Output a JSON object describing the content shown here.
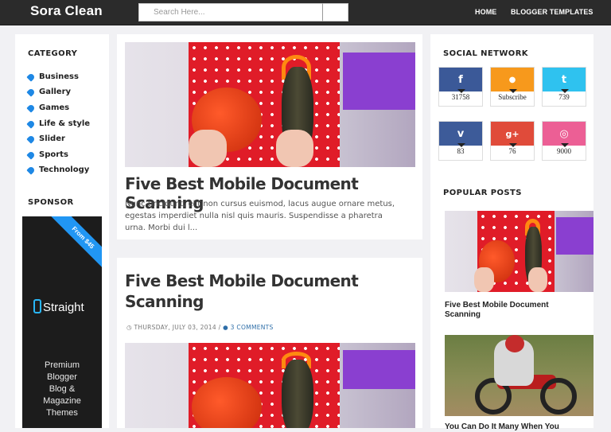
{
  "header": {
    "logo": "Sora Clean",
    "search_placeholder": "Search Here...",
    "nav": [
      "HOME",
      "BLOGGER TEMPLATES"
    ]
  },
  "left_sidebar": {
    "category_title": "CATEGORY",
    "categories": [
      "Business",
      "Gallery",
      "Games",
      "Life & style",
      "Slider",
      "Sports",
      "Technology"
    ],
    "sponsor_title": "SPONSOR",
    "sponsor": {
      "ribbon": "From $45",
      "brand": "Straight",
      "promo_lines": [
        "Premium",
        "Blogger",
        "Blog &",
        "Magazine",
        "Themes"
      ]
    }
  },
  "posts": [
    {
      "title": "Five Best Mobile Document Scanning",
      "excerpt_lines": [
        "Nunc tincidunt, elit non cursus euismod, lacus augue ornare metus,",
        "egestas imperdiet nulla nisl quis mauris. Suspendisse a pharetra",
        "urna. Morbi dui l..."
      ]
    },
    {
      "title_lines": [
        "Five Best Mobile Document",
        "Scanning"
      ],
      "date": "THURSDAY, JULY 03, 2014",
      "separator": "/",
      "comments": "3 COMMENTS"
    }
  ],
  "right_sidebar": {
    "social_title": "SOCIAL NETWORK",
    "social": [
      {
        "icon": "facebook-icon",
        "glyph": "f",
        "color": "#3b5998",
        "count": "31758"
      },
      {
        "icon": "rss-icon",
        "glyph": "●",
        "color": "#f7991c",
        "count": "Subscribe"
      },
      {
        "icon": "twitter-icon",
        "glyph": "t",
        "color": "#2fc2ef",
        "count": "739"
      },
      {
        "icon": "vimeo-icon",
        "glyph": "v",
        "color": "#3d5b99",
        "count": "83"
      },
      {
        "icon": "google-plus-icon",
        "glyph": "g+",
        "color": "#e04b3a",
        "count": "76"
      },
      {
        "icon": "dribbble-icon",
        "glyph": "◎",
        "color": "#ec5f95",
        "count": "9000"
      }
    ],
    "popular_title": "POPULAR POSTS",
    "popular": [
      {
        "title_lines": [
          "Five Best Mobile Document",
          "Scanning"
        ]
      },
      {
        "title_lines": [
          "You Can Do It Many When You"
        ]
      }
    ]
  }
}
